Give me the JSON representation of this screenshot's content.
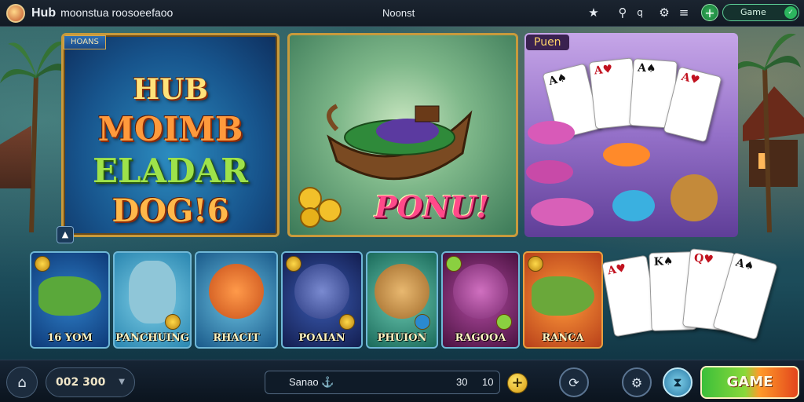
{
  "topbar": {
    "app_name": "Hub",
    "subtitle": "moonstua roosoeefaoo",
    "center_label": "Noonst",
    "icons": [
      "star-icon",
      "search-icon",
      "gear-icon",
      "menu-icon",
      "plus-icon"
    ],
    "game_pill_label": "Game"
  },
  "banners": {
    "featured": {
      "tag": "HOANS",
      "lines": [
        "HUB",
        "MOIMB",
        "ELADAR",
        "DOG!6"
      ]
    },
    "boat": {
      "caption": "PONU!"
    },
    "cards": {
      "tag": "Puen"
    }
  },
  "tiles": [
    {
      "label": "16 YOM"
    },
    {
      "label": "PANCHUING"
    },
    {
      "label": "RHACIT"
    },
    {
      "label": "POAIAN"
    },
    {
      "label": "PHUION"
    },
    {
      "label": "RAGOOA"
    },
    {
      "label": "RANCA"
    }
  ],
  "bottombar": {
    "select_value": "002 300",
    "search_label": "Sanao ⚓",
    "value_1": "30",
    "value_2": "10",
    "coin_symbol": "+",
    "game_button": "GAME"
  },
  "colors": {
    "accent_gold": "#c89a3c",
    "game_button_green": "#3bbf3a",
    "game_button_orange": "#e2451c",
    "topbar_bg": "#121a24"
  }
}
